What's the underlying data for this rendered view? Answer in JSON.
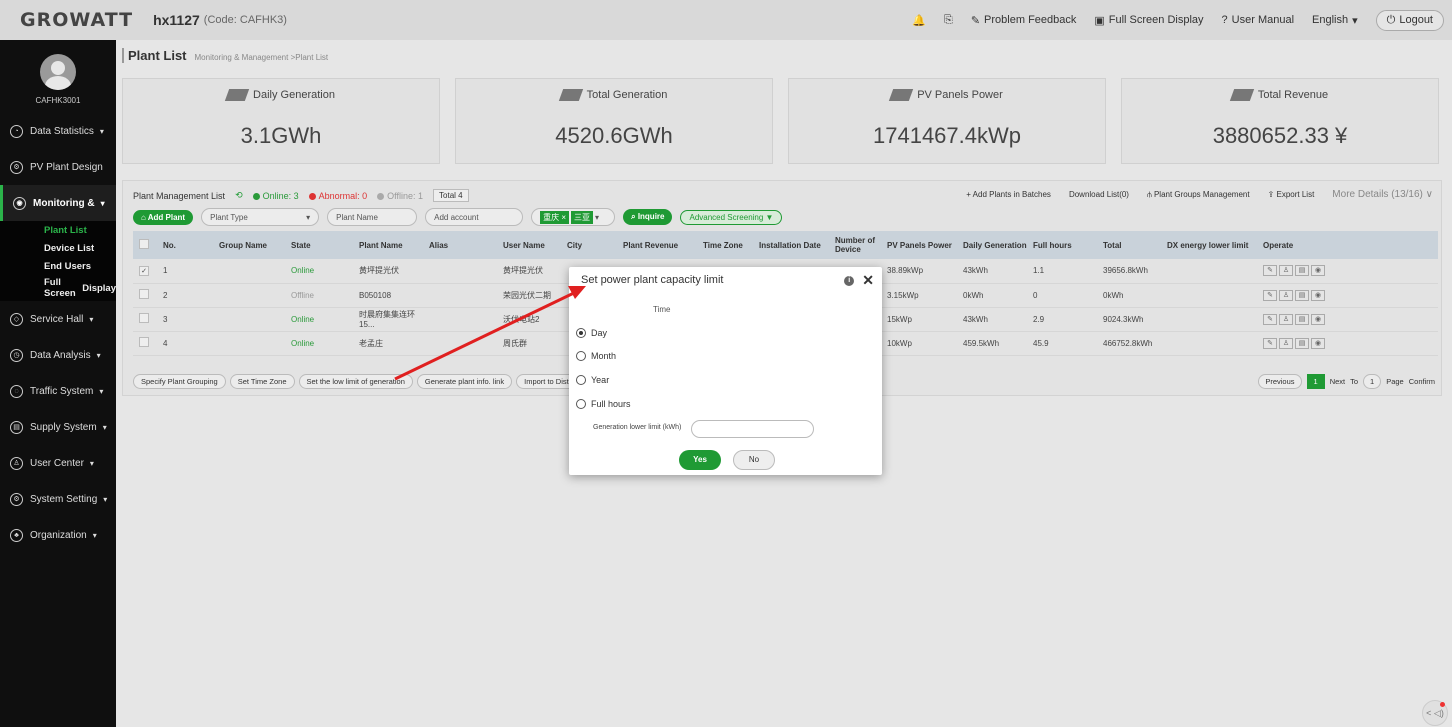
{
  "header": {
    "logo": "GROWATT",
    "plant": "hx1127",
    "code": "(Code: CAFHK3)",
    "links": [
      "Problem Feedback",
      "Full Screen Display",
      "User Manual",
      "English",
      "Logout"
    ]
  },
  "sidebar": {
    "user": "CAFHK3001",
    "items": [
      {
        "label": "Data Statistics",
        "icon": "chart-icon"
      },
      {
        "label": "PV Plant Design",
        "icon": "design-icon"
      },
      {
        "label": "Monitoring &",
        "icon": "monitor-icon"
      },
      {
        "label": "Service Hall",
        "icon": "service-icon"
      },
      {
        "label": "Data Analysis",
        "icon": "analysis-icon"
      },
      {
        "label": "Traffic System",
        "icon": "traffic-icon"
      },
      {
        "label": "Supply System",
        "icon": "supply-icon"
      },
      {
        "label": "User Center",
        "icon": "user-icon"
      },
      {
        "label": "System Setting",
        "icon": "settings-icon"
      },
      {
        "label": "Organization",
        "icon": "org-icon"
      }
    ],
    "sub": [
      "Plant List",
      "Device List",
      "End Users",
      "Full Screen",
      "Display"
    ]
  },
  "breadcrumb": {
    "title": "Plant List",
    "path": "Monitoring & Management >Plant List"
  },
  "cards": [
    {
      "title": "Daily Generation",
      "value": "3.1GWh"
    },
    {
      "title": "Total Generation",
      "value": "4520.6GWh"
    },
    {
      "title": "PV Panels Power",
      "value": "1741467.4kWp"
    },
    {
      "title": "Total Revenue",
      "value": "3880652.33 ¥"
    }
  ],
  "plist": {
    "title": "Plant Management List",
    "online": "Online: 3",
    "abnormal": "Abnormal: 0",
    "offline": "Offline: 1",
    "total": "Total 4",
    "right": [
      "Add Plants in Batches",
      "Download List(0)",
      "Plant Groups Management",
      "Export List",
      "More Details (13/16)"
    ],
    "add_plant": "Add Plant",
    "plant_type": "Plant Type",
    "plant_name": "Plant Name",
    "add_account": "Add account",
    "tags": [
      "重庆 ×",
      "三亚"
    ],
    "inquire": "Inquire",
    "advanced": "Advanced Screening"
  },
  "table": {
    "headers": [
      "No.",
      "Group Name",
      "State",
      "Plant Name",
      "Alias",
      "User Name",
      "City",
      "Plant Revenue",
      "Time Zone",
      "Installation Date",
      "Number of Device",
      "PV Panels Power",
      "Daily Generation",
      "Full hours",
      "Total",
      "DX energy lower limit",
      "Operate"
    ],
    "rows": [
      {
        "no": "1",
        "state": "Online",
        "plant": "黄坪提光伏",
        "user": "黄坪提光伏",
        "pv": "38.89kWp",
        "daily": "43kWh",
        "full": "1.1",
        "total": "39656.8kWh"
      },
      {
        "no": "2",
        "state": "Offline",
        "plant": "B050108",
        "user": "荣园光伏二期",
        "pv": "3.15kWp",
        "daily": "0kWh",
        "full": "0",
        "total": "0kWh"
      },
      {
        "no": "3",
        "state": "Online",
        "plant": "时晨府集集连环15...",
        "user": "沃伏电站2",
        "pv": "15kWp",
        "daily": "43kWh",
        "full": "2.9",
        "total": "9024.3kWh"
      },
      {
        "no": "4",
        "state": "Online",
        "plant": "老孟庄",
        "user": "周氏群",
        "pv": "10kWp",
        "daily": "459.5kWh",
        "full": "45.9",
        "total": "466752.8kWh"
      }
    ]
  },
  "actions": [
    "Specify Plant Grouping",
    "Set Time Zone",
    "Set the low limit of generation",
    "Generate plant info. link",
    "Import to Distr"
  ],
  "pager": {
    "prev": "Previous",
    "page": "1",
    "next": "Next",
    "to": "To",
    "input": "1",
    "page_label": "Page",
    "confirm": "Confirm"
  },
  "modal": {
    "title": "Set power plant capacity limit",
    "time_label": "Time",
    "options": [
      "Day",
      "Month",
      "Year",
      "Full hours"
    ],
    "selected": "Day",
    "gen_label": "Generation lower limit (kWh)",
    "gen_value": "",
    "yes": "Yes",
    "no": "No"
  },
  "colors": {
    "accent": "#1f9a34",
    "arrow": "#e02020"
  }
}
